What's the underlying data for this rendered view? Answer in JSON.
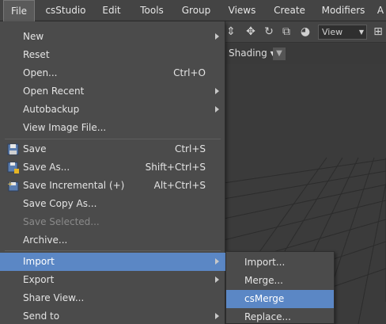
{
  "menubar": {
    "items": [
      {
        "label": "File",
        "active": true
      },
      {
        "label": "csStudio"
      },
      {
        "label": "Edit"
      },
      {
        "label": "Tools"
      },
      {
        "label": "Group"
      },
      {
        "label": "Views"
      },
      {
        "label": "Create"
      },
      {
        "label": "Modifiers"
      },
      {
        "label": "A"
      }
    ]
  },
  "toolbar": {
    "view_select": "View",
    "shading_label": "Shading"
  },
  "file_menu": {
    "items": [
      {
        "label": "New",
        "shortcut": "",
        "submenu": true
      },
      {
        "label": "Reset",
        "shortcut": ""
      },
      {
        "label": "Open...",
        "shortcut": "Ctrl+O"
      },
      {
        "label": "Open Recent",
        "shortcut": "",
        "submenu": true
      },
      {
        "label": "Autobackup",
        "shortcut": "",
        "submenu": true
      },
      {
        "label": "View Image File...",
        "shortcut": ""
      },
      {
        "label": "Save",
        "shortcut": "Ctrl+S",
        "icon": "save-icon"
      },
      {
        "label": "Save As...",
        "shortcut": "Shift+Ctrl+S",
        "icon": "save-as-icon"
      },
      {
        "label": "Save Incremental (+)",
        "shortcut": "Alt+Ctrl+S",
        "icon": "save-incremental-icon"
      },
      {
        "label": "Save Copy As...",
        "shortcut": ""
      },
      {
        "label": "Save Selected...",
        "shortcut": "",
        "disabled": true
      },
      {
        "label": "Archive...",
        "shortcut": ""
      },
      {
        "label": "Import",
        "shortcut": "",
        "submenu": true,
        "highlight": true
      },
      {
        "label": "Export",
        "shortcut": "",
        "submenu": true
      },
      {
        "label": "Share View...",
        "shortcut": ""
      },
      {
        "label": "Send to",
        "shortcut": "",
        "submenu": true
      }
    ]
  },
  "import_submenu": {
    "items": [
      {
        "label": "Import..."
      },
      {
        "label": "Merge..."
      },
      {
        "label": "csMerge",
        "highlight": true
      },
      {
        "label": "Replace..."
      }
    ]
  },
  "colors": {
    "highlight": "#5b87c5",
    "menu_bg": "#4b4b4b",
    "menubar_bg": "#444444"
  }
}
